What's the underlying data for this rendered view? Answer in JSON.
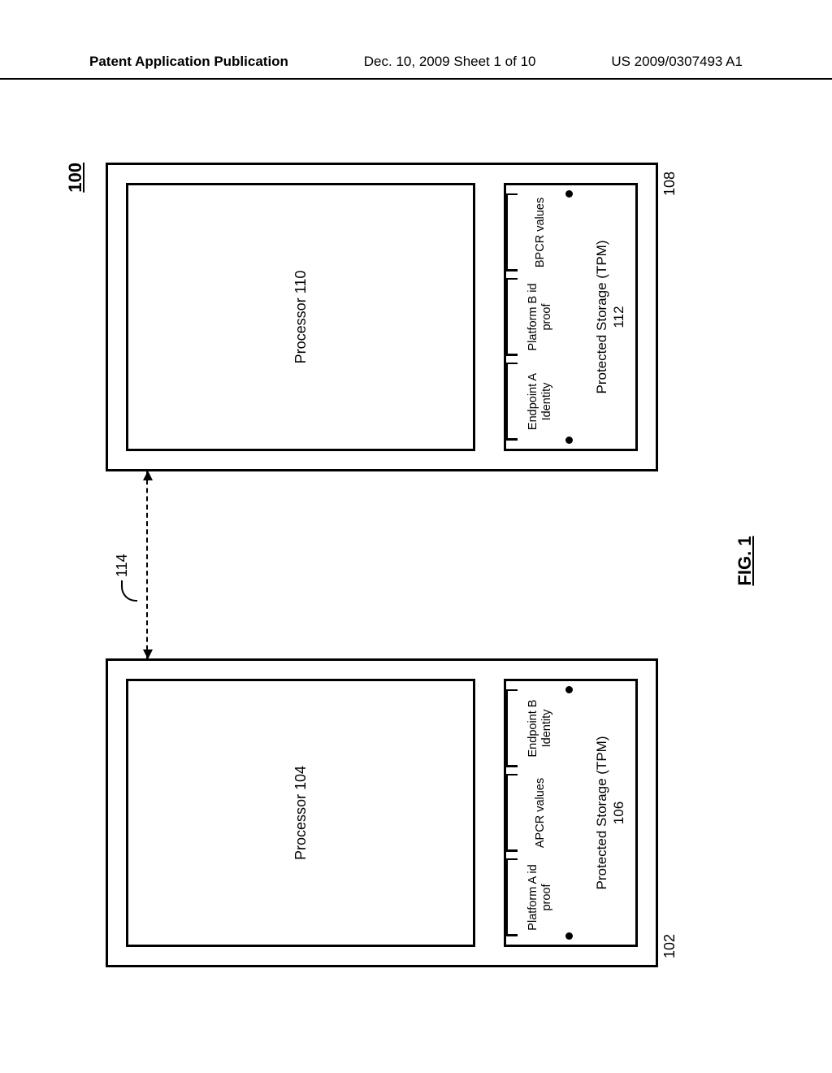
{
  "header": {
    "left": "Patent Application Publication",
    "middle": "Dec. 10, 2009  Sheet 1 of 10",
    "right": "US 2009/0307493 A1"
  },
  "figure": {
    "ref": "100",
    "caption": "FIG. 1",
    "link_ref": "114"
  },
  "platform_a": {
    "ref": "102",
    "processor": "Processor 104",
    "tpm_label_line1": "Protected Storage (TPM)",
    "tpm_label_line2": "106",
    "slots": [
      "Platform A id proof",
      "APCR values",
      "Endpoint B Identity"
    ]
  },
  "platform_b": {
    "ref": "108",
    "processor": "Processor 110",
    "tpm_label_line1": "Protected Storage (TPM)",
    "tpm_label_line2": "112",
    "slots": [
      "Endpoint A Identity",
      "Platform B id proof",
      "BPCR values"
    ]
  }
}
